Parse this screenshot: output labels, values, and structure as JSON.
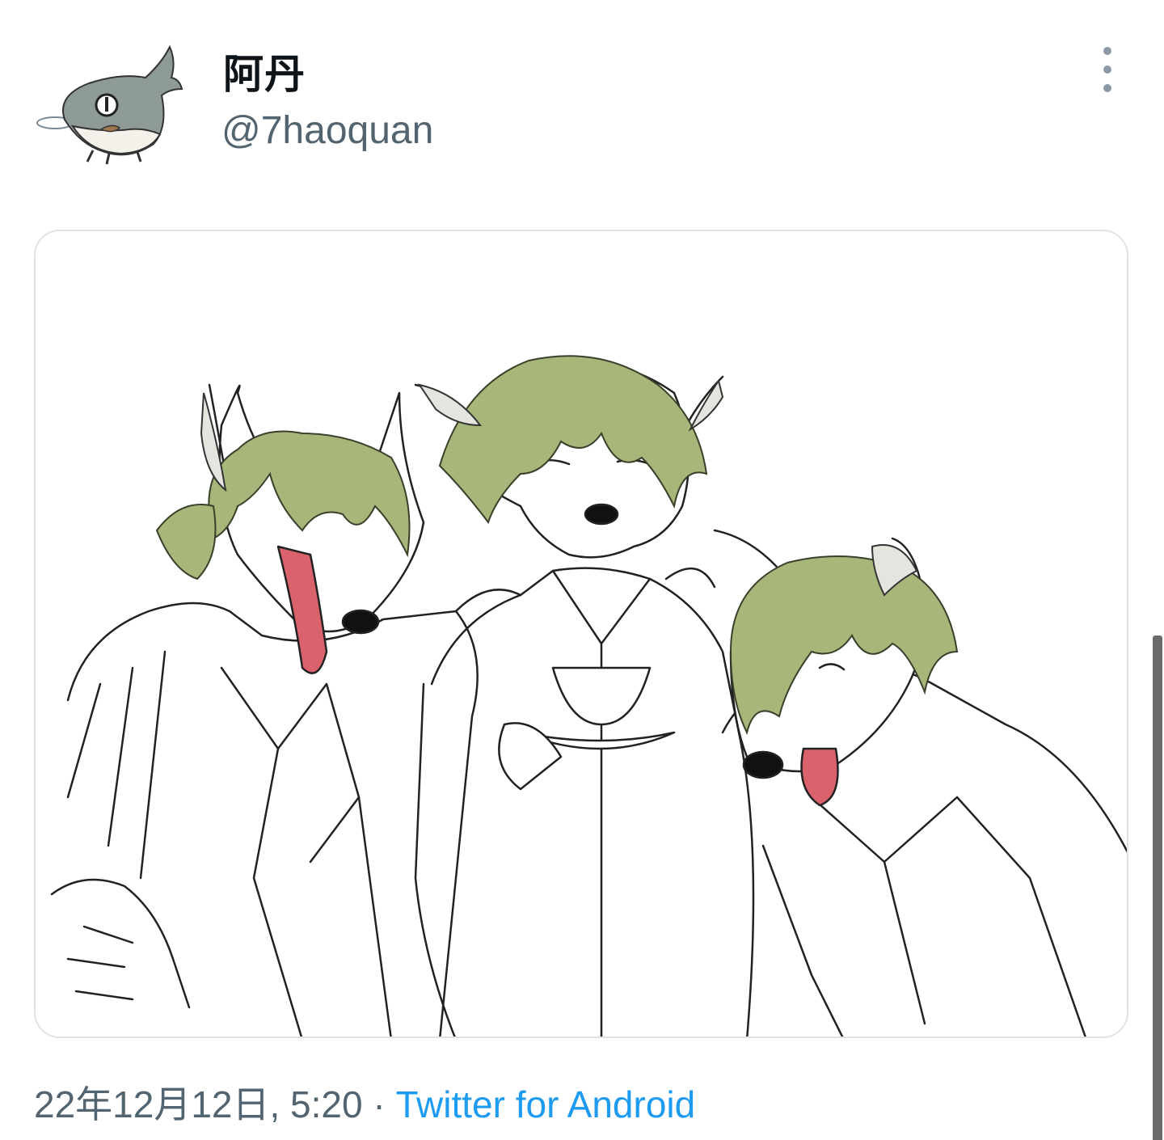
{
  "tweet": {
    "display_name": "阿丹",
    "handle": "@7haoquan",
    "date_time": "22年12月12日, 5:20",
    "separator": " · ",
    "source": "Twitter for Android"
  },
  "icons": {
    "avatar": "shark-cat-avatar-icon",
    "more": "more-vertical-icon"
  },
  "media": {
    "description_hidden": true
  },
  "colors": {
    "link": "#1d9bf0",
    "secondary_text": "#536471",
    "card_border": "#dfe3e7",
    "hair_green": "#a7b77a",
    "tongue": "#d9626c"
  }
}
